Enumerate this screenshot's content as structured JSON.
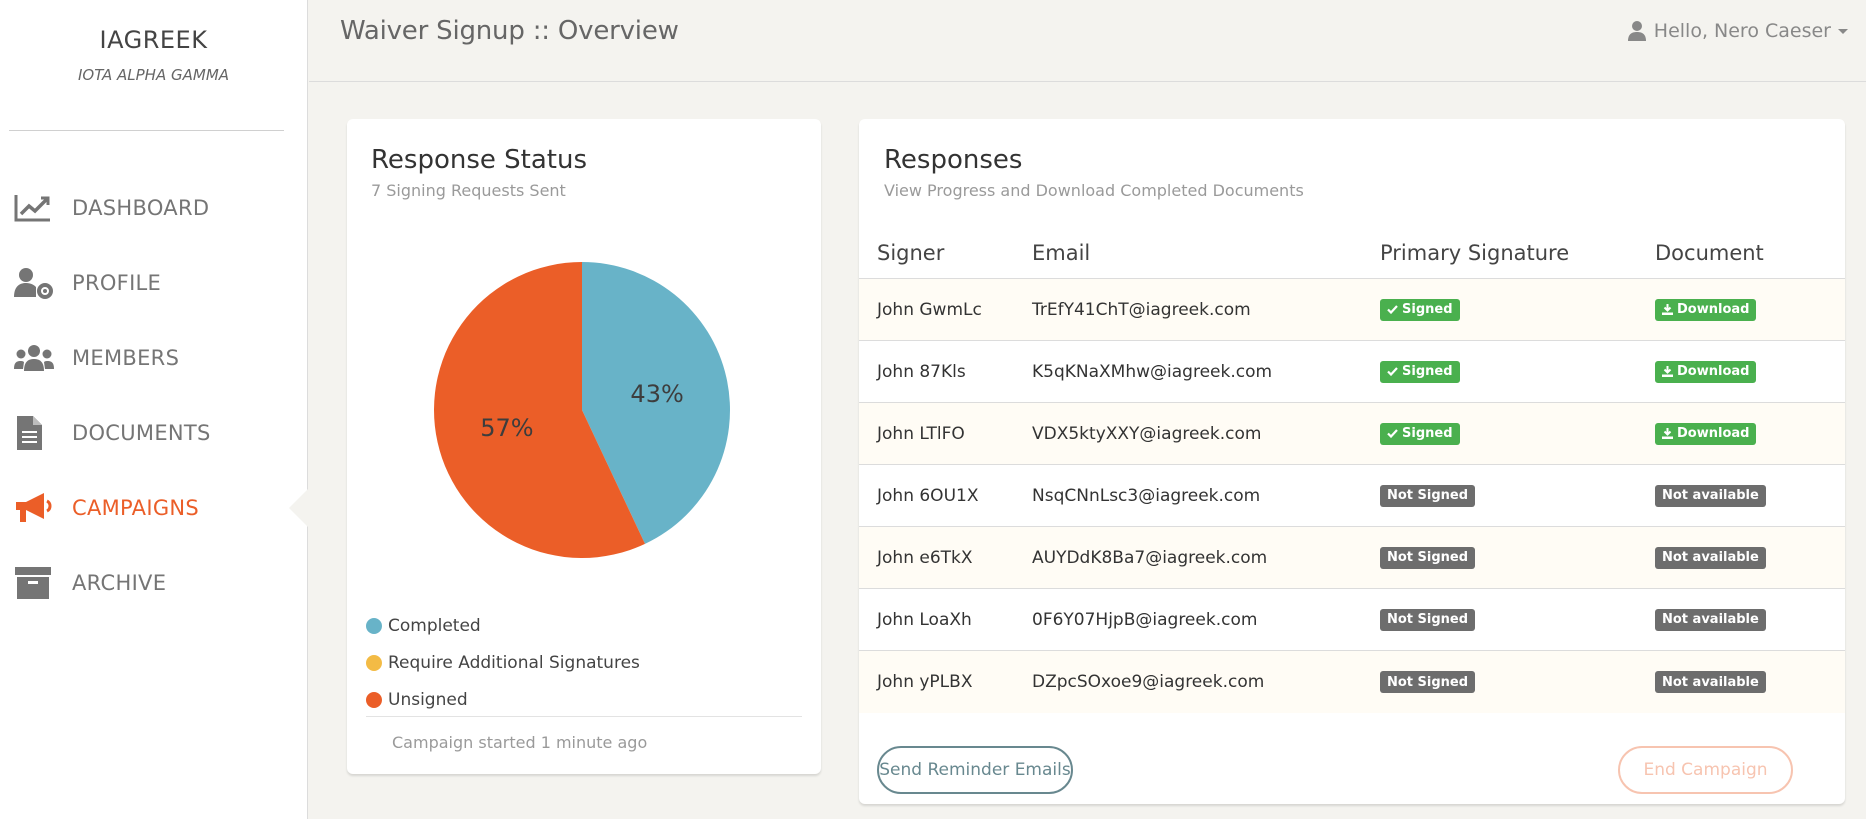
{
  "brand": {
    "name": "IAGREEK",
    "subtitle": "IOTA ALPHA GAMMA"
  },
  "sidebar": {
    "items": [
      {
        "label": "DASHBOARD",
        "icon": "chart-line-icon",
        "active": false
      },
      {
        "label": "PROFILE",
        "icon": "user-gear-icon",
        "active": false
      },
      {
        "label": "MEMBERS",
        "icon": "users-icon",
        "active": false
      },
      {
        "label": "DOCUMENTS",
        "icon": "document-icon",
        "active": false
      },
      {
        "label": "CAMPAIGNS",
        "icon": "megaphone-icon",
        "active": true
      },
      {
        "label": "ARCHIVE",
        "icon": "archive-icon",
        "active": false
      }
    ]
  },
  "header": {
    "title": "Waiver Signup :: Overview",
    "user_greeting": "Hello, Nero Caeser",
    "user_icon": "user-icon"
  },
  "status_card": {
    "title": "Response Status",
    "subtitle": "7 Signing Requests Sent",
    "footer": "Campaign started 1 minute ago",
    "legend": [
      {
        "label": "Completed",
        "color": "#68b3c8"
      },
      {
        "label": "Require Additional Signatures",
        "color": "#f3bb45"
      },
      {
        "label": "Unsigned",
        "color": "#eb5e28"
      }
    ]
  },
  "chart_data": {
    "type": "pie",
    "slices": [
      {
        "label": "Completed",
        "value": 43,
        "display": "43%",
        "color": "#68b3c8"
      },
      {
        "label": "Unsigned",
        "value": 57,
        "display": "57%",
        "color": "#eb5e28"
      }
    ]
  },
  "responses_card": {
    "title": "Responses",
    "subtitle": "View Progress and Download Completed Documents",
    "columns": [
      "Signer",
      "Email",
      "Primary Signature",
      "Document"
    ],
    "rows": [
      {
        "signer": "John GwmLc",
        "email": "TrEfY41ChT@iagreek.com",
        "signature": "Signed",
        "document": "Download",
        "signed": true
      },
      {
        "signer": "John 87Kls",
        "email": "K5qKNaXMhw@iagreek.com",
        "signature": "Signed",
        "document": "Download",
        "signed": true
      },
      {
        "signer": "John LTlFO",
        "email": "VDX5ktyXXY@iagreek.com",
        "signature": "Signed",
        "document": "Download",
        "signed": true
      },
      {
        "signer": "John 6OU1X",
        "email": "NsqCNnLsc3@iagreek.com",
        "signature": "Not Signed",
        "document": "Not available",
        "signed": false
      },
      {
        "signer": "John e6TkX",
        "email": "AUYDdK8Ba7@iagreek.com",
        "signature": "Not Signed",
        "document": "Not available",
        "signed": false
      },
      {
        "signer": "John LoaXh",
        "email": "0F6Y07HjpB@iagreek.com",
        "signature": "Not Signed",
        "document": "Not available",
        "signed": false
      },
      {
        "signer": "John yPLBX",
        "email": "DZpcSOxoe9@iagreek.com",
        "signature": "Not Signed",
        "document": "Not available",
        "signed": false
      }
    ],
    "reminder_button": "Send Reminder Emails",
    "end_button": "End Campaign"
  }
}
